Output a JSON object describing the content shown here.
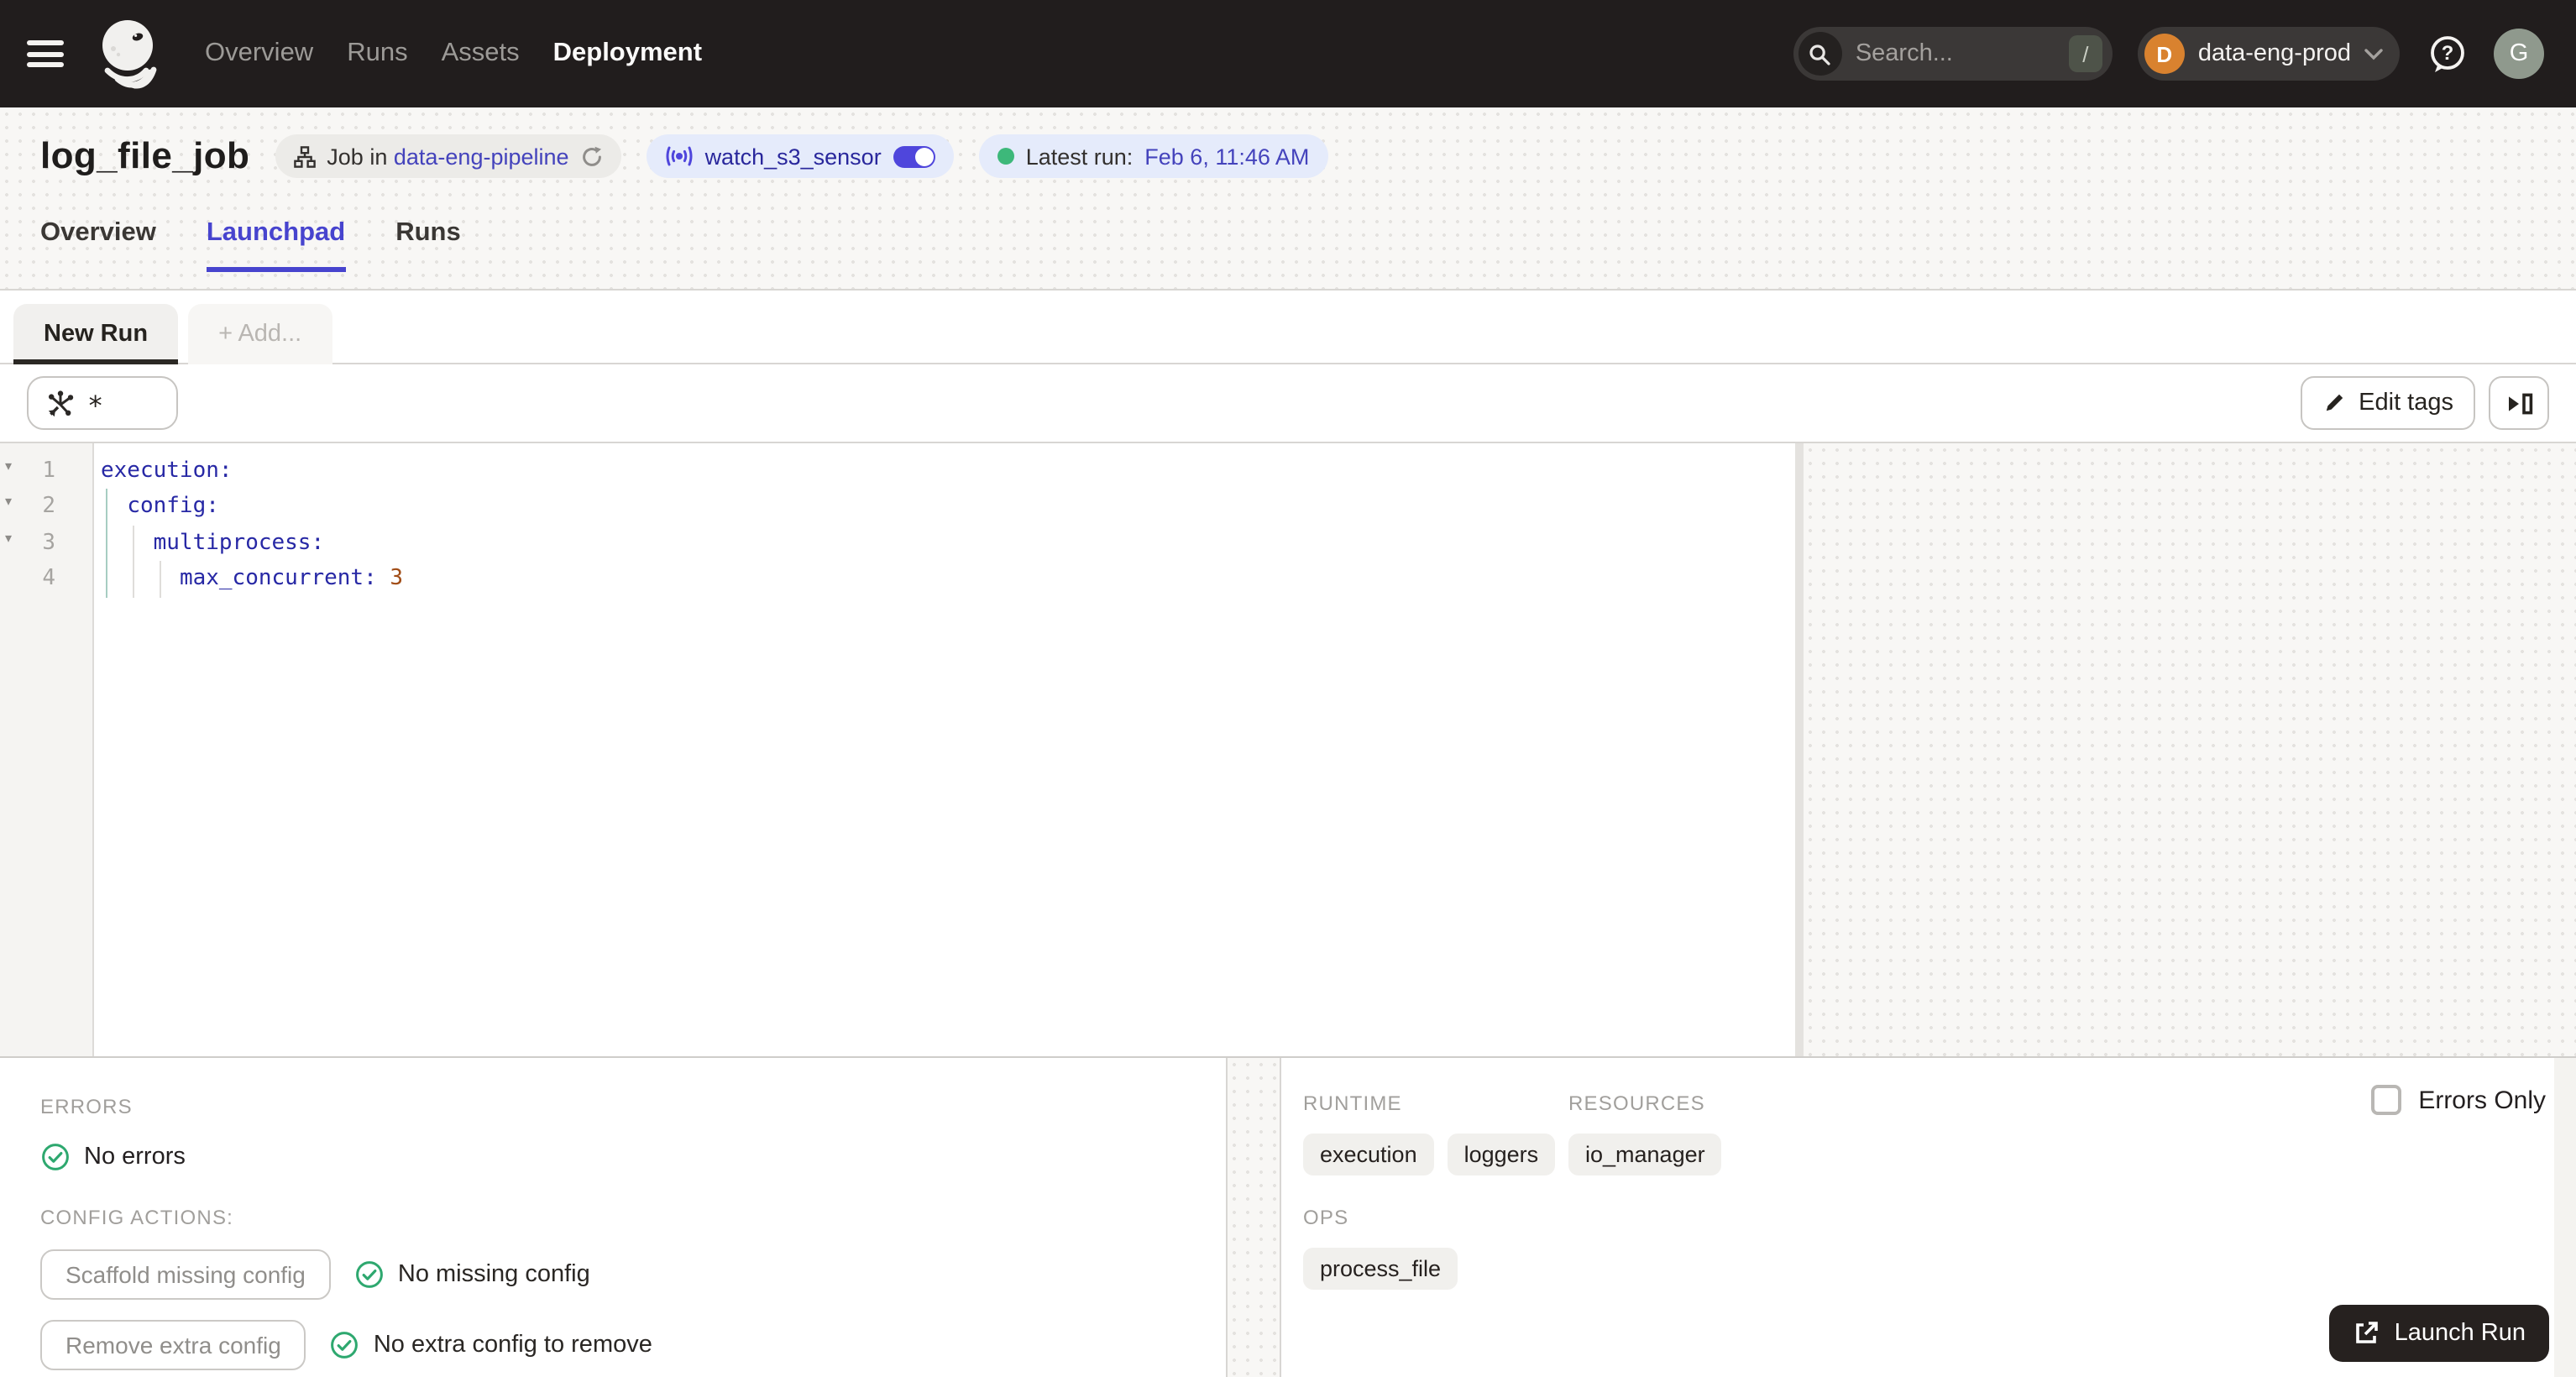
{
  "topnav": {
    "items": [
      {
        "label": "Overview"
      },
      {
        "label": "Runs"
      },
      {
        "label": "Assets"
      },
      {
        "label": "Deployment"
      }
    ],
    "search_placeholder": "Search...",
    "search_shortcut": "/",
    "workspace_initial": "D",
    "workspace_name": "data-eng-prod",
    "user_initial": "G"
  },
  "header": {
    "title": "log_file_job",
    "job_pill": {
      "prefix": "Job in",
      "link": "data-eng-pipeline"
    },
    "sensor_pill": {
      "name": "watch_s3_sensor"
    },
    "latest_run_pill": {
      "label": "Latest run:",
      "value": "Feb 6, 11:46 AM"
    },
    "tabs": [
      {
        "label": "Overview"
      },
      {
        "label": "Launchpad"
      },
      {
        "label": "Runs"
      }
    ]
  },
  "run_tabs": {
    "new_run": "New Run",
    "add": "+ Add..."
  },
  "toolbar": {
    "op_selector_value": "*",
    "edit_tags": "Edit tags"
  },
  "editor": {
    "lines": [
      {
        "num": "1",
        "indent": "",
        "key": "execution:",
        "value": ""
      },
      {
        "num": "2",
        "indent": "  ",
        "key": "config:",
        "value": ""
      },
      {
        "num": "3",
        "indent": "    ",
        "key": "multiprocess:",
        "value": ""
      },
      {
        "num": "4",
        "indent": "      ",
        "key": "max_concurrent: ",
        "value": "3"
      }
    ]
  },
  "bottom": {
    "errors_label": "ERRORS",
    "no_errors": "No errors",
    "config_actions_label": "CONFIG ACTIONS:",
    "scaffold_button": "Scaffold missing config",
    "scaffold_status": "No missing config",
    "remove_button": "Remove extra config",
    "remove_status": "No extra config to remove",
    "runtime_label": "RUNTIME",
    "runtime_tags": [
      "execution",
      "loggers"
    ],
    "resources_label": "RESOURCES",
    "resources_tags": [
      "io_manager"
    ],
    "ops_label": "OPS",
    "ops_tags": [
      "process_file"
    ],
    "errors_only_label": "Errors Only",
    "launch_run": "Launch Run"
  },
  "icons": {
    "fold_arrow": "▾",
    "chevron_down": "▾"
  },
  "colors": {
    "nav_bg": "#211D1D",
    "accent_indigo": "#4744CE",
    "link_blue": "#4443BC",
    "sensor_indigo": "#4F46DC",
    "success_green": "#2EA86F",
    "run_dot_green": "#3DB87A",
    "workspace_orange": "#D9822F",
    "yaml_key": "#2728A5",
    "yaml_number": "#A14D17"
  }
}
